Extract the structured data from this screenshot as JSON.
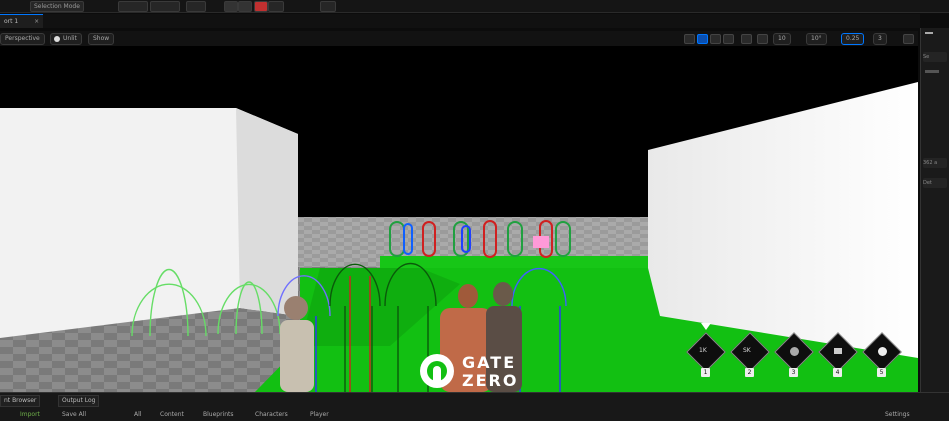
{
  "toolbar": {
    "mode_label": "Selection Mode",
    "chips": [
      "",
      "",
      "",
      ""
    ]
  },
  "viewport_tab": {
    "label": "ort 1",
    "close": "×"
  },
  "viewport_toolbar": {
    "perspective_label": "Perspective",
    "lit_label": "Unlit",
    "show_label": "Show",
    "right_values": [
      "10",
      "10°",
      "0.25",
      "3"
    ]
  },
  "right_panel": {
    "items": [
      "Se",
      "362 a",
      "Det"
    ]
  },
  "hotbar": {
    "slots": [
      {
        "key": "1",
        "icon": "gun-icon",
        "top_label": "1K",
        "sub": ""
      },
      {
        "key": "2",
        "icon": "gun-icon",
        "top_label": "SK",
        "sub": ""
      },
      {
        "key": "3",
        "icon": "orb-icon",
        "top_label": "",
        "sub": ""
      },
      {
        "key": "4",
        "icon": "spark-icon",
        "top_label": "",
        "sub": ""
      },
      {
        "key": "5",
        "icon": "burst-icon",
        "top_label": "",
        "sub": ""
      }
    ]
  },
  "logo": {
    "line1": "GATE",
    "line2": "ZERO"
  },
  "bottom": {
    "tab_content_browser": "nt Browser",
    "tab_output_log": "Output Log",
    "import_label": "Import",
    "save_all_label": "Save All",
    "breadcrumbs": [
      "All",
      "Content",
      "Blueprints",
      "Characters",
      "Player"
    ],
    "settings_label": "Settings"
  },
  "colors": {
    "accent": "#0077ff",
    "floor_green": "#10c010",
    "wall_white": "#f2f2f2"
  }
}
